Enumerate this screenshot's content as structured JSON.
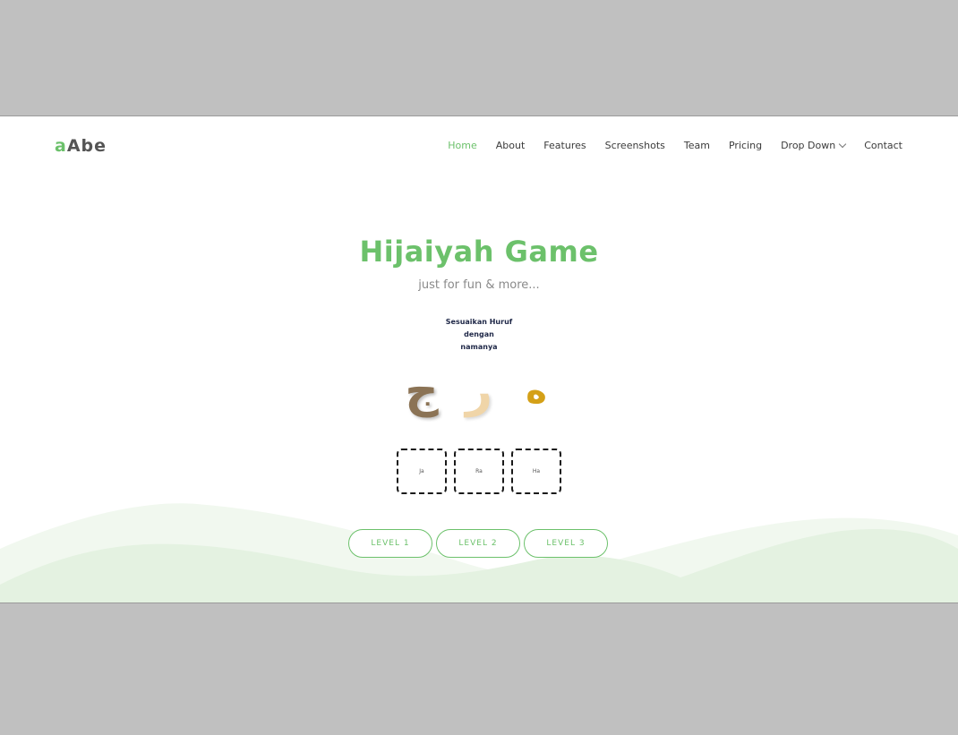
{
  "logo": {
    "accent": "a",
    "rest": "Abe"
  },
  "nav": {
    "items": [
      {
        "label": "Home",
        "active": true
      },
      {
        "label": "About"
      },
      {
        "label": "Features"
      },
      {
        "label": "Screenshots"
      },
      {
        "label": "Team"
      },
      {
        "label": "Pricing"
      },
      {
        "label": "Drop Down"
      },
      {
        "label": "Contact"
      }
    ]
  },
  "hero": {
    "title": "Hijaiyah Game",
    "subtitle": "just for fun & more...",
    "instruction_line1": "Sesuaikan Huruf dengan",
    "instruction_line2": "namanya"
  },
  "game": {
    "letters": [
      {
        "glyph": "ج",
        "color": "#8b7355"
      },
      {
        "glyph": "ر",
        "color": "#f0d5a8"
      },
      {
        "glyph": "ه",
        "color": "#d4a017"
      }
    ],
    "drop_targets": [
      "Ja",
      "Ra",
      "Ha"
    ]
  },
  "levels": [
    "LEVEL 1",
    "LEVEL 2",
    "LEVEL 3"
  ],
  "colors": {
    "accent": "#6cc16b",
    "wave_light": "#f1f8ef",
    "wave_mid": "#e4f2e1",
    "background_outer": "#c0c0c0"
  }
}
